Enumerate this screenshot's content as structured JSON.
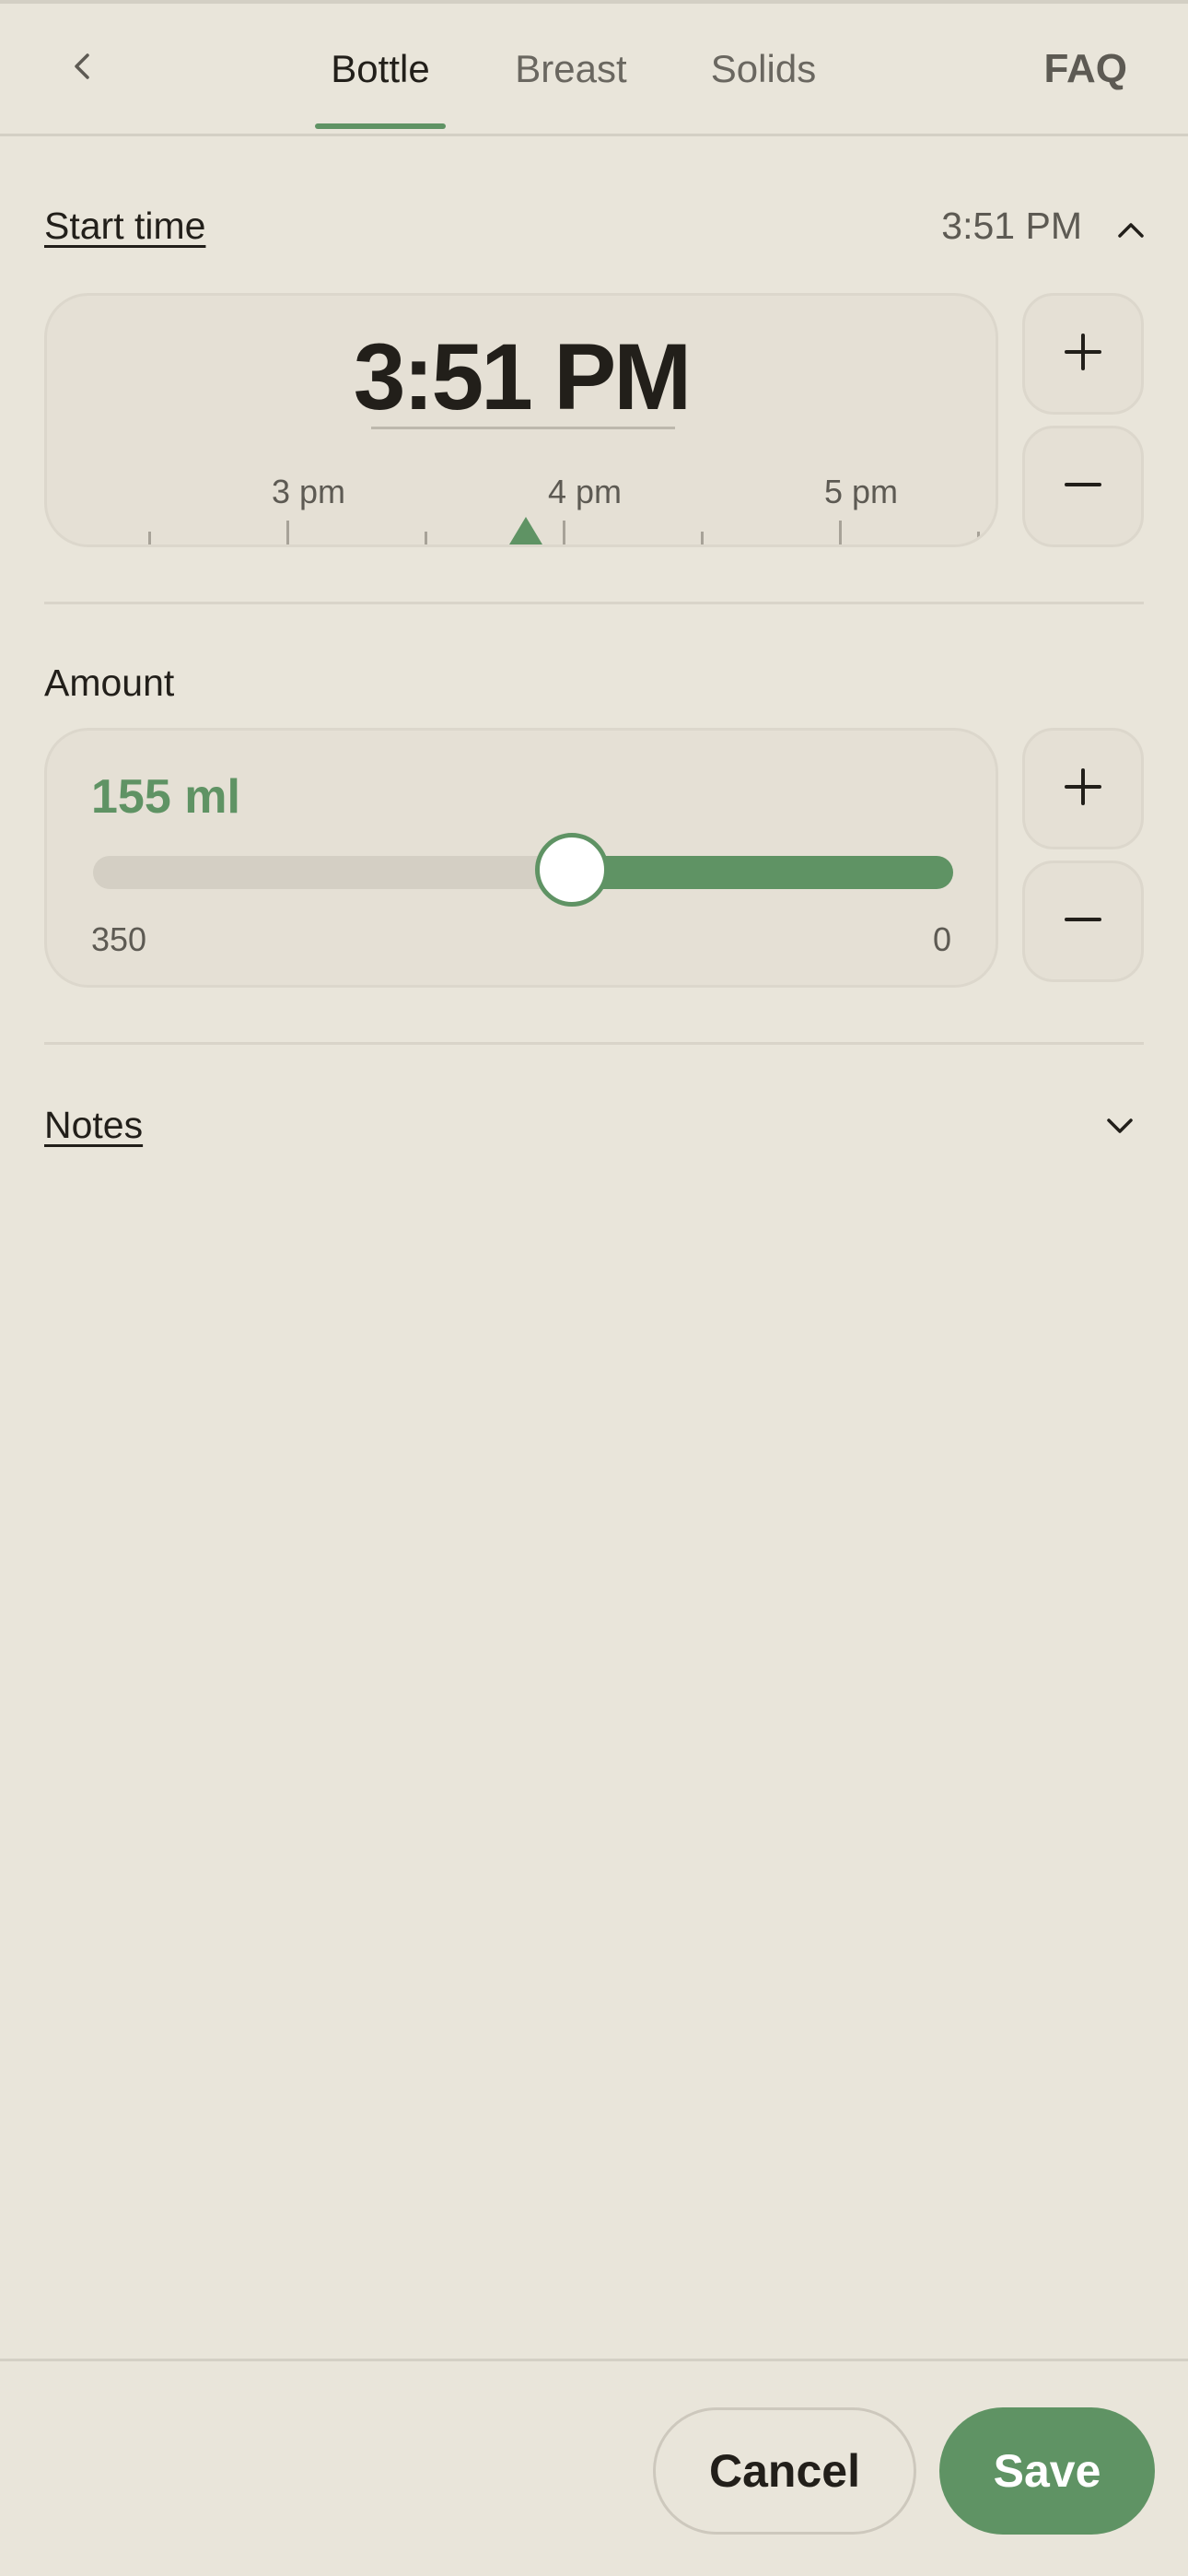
{
  "header": {
    "tabs": [
      {
        "label": "Bottle",
        "active": true
      },
      {
        "label": "Breast",
        "active": false
      },
      {
        "label": "Solids",
        "active": false
      }
    ],
    "faq_label": "FAQ"
  },
  "start_time": {
    "label": "Start time",
    "summary_value": "3:51 PM",
    "expanded": true,
    "big_value": "3:51 PM",
    "timeline_labels": [
      "3 pm",
      "4 pm",
      "5 pm"
    ]
  },
  "amount": {
    "label": "Amount",
    "value_text": "155 ml",
    "value_ml": 155,
    "range_max_label": "350",
    "range_min_label": "0",
    "max": 350,
    "min": 0
  },
  "notes": {
    "label": "Notes",
    "expanded": false
  },
  "footer": {
    "cancel_label": "Cancel",
    "save_label": "Save"
  },
  "colors": {
    "accent": "#5f9364",
    "background": "#e9e5da",
    "card": "#e5e0d5"
  }
}
